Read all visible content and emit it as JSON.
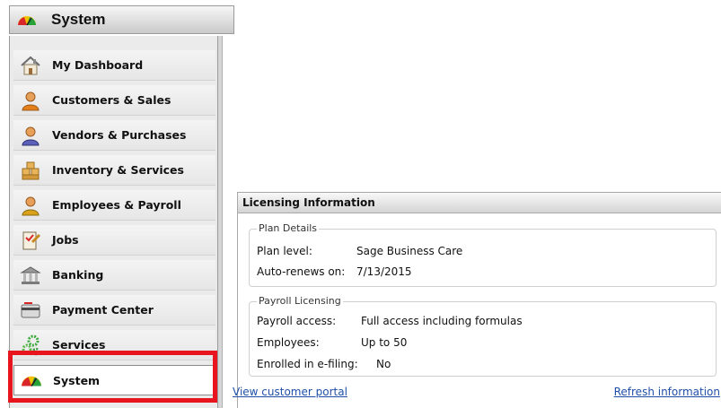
{
  "nav": {
    "header_title": "System",
    "items": [
      {
        "label": "My Dashboard",
        "icon": "house-icon"
      },
      {
        "label": "Customers & Sales",
        "icon": "person-icon"
      },
      {
        "label": "Vendors & Purchases",
        "icon": "person-icon"
      },
      {
        "label": "Inventory & Services",
        "icon": "boxes-icon"
      },
      {
        "label": "Employees & Payroll",
        "icon": "person-icon"
      },
      {
        "label": "Jobs",
        "icon": "clipboard-icon"
      },
      {
        "label": "Banking",
        "icon": "bank-icon"
      },
      {
        "label": "Payment Center",
        "icon": "credit-card-icon"
      },
      {
        "label": "Services",
        "icon": "gears-icon"
      },
      {
        "label": "System",
        "icon": "gauge-icon",
        "selected": true
      }
    ]
  },
  "licensing": {
    "title": "Licensing Information",
    "plan_details": {
      "legend": "Plan Details",
      "rows": [
        {
          "key": "Plan level:",
          "value": "Sage Business Care"
        },
        {
          "key": "Auto-renews on:",
          "value": "7/13/2015"
        }
      ]
    },
    "payroll_licensing": {
      "legend": "Payroll Licensing",
      "rows": [
        {
          "key": "Payroll access:",
          "value": "Full access including formulas"
        },
        {
          "key": "Employees:",
          "value": "Up to 50"
        },
        {
          "key": "Enrolled in e-filing:",
          "value": "No"
        }
      ]
    },
    "links": {
      "portal": "View customer portal",
      "refresh": "Refresh information"
    }
  },
  "colors": {
    "highlight": "#e8141e",
    "link": "#1f4fa8"
  }
}
